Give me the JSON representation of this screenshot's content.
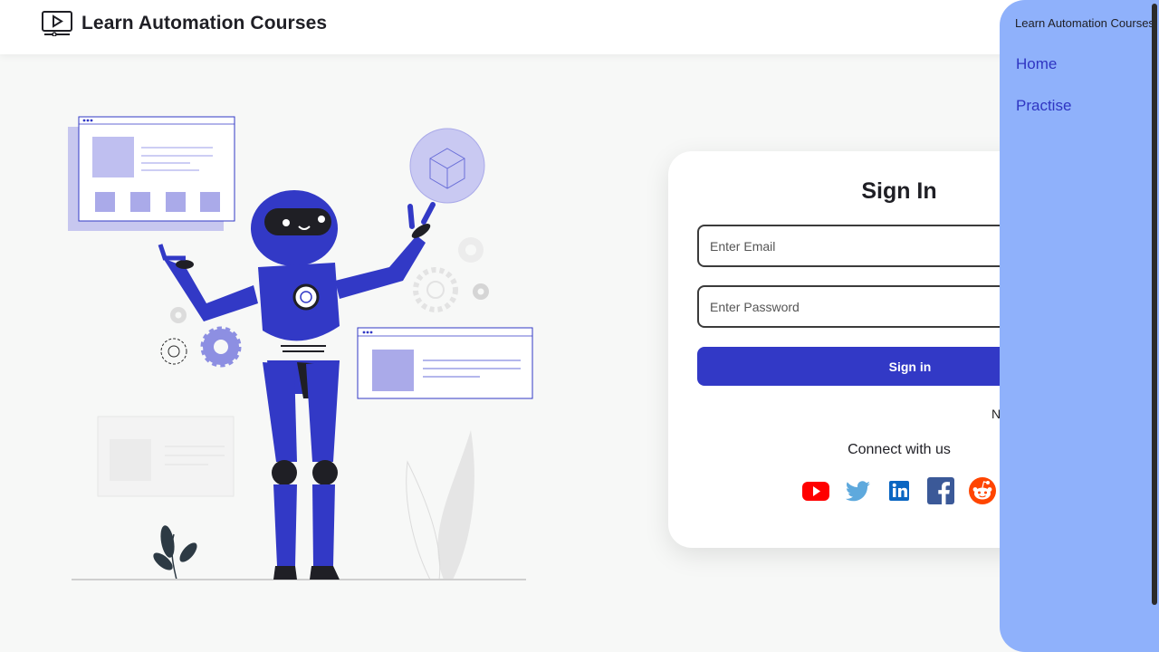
{
  "header": {
    "brand_icon": "video-player-icon",
    "brand_title": "Learn Automation Courses"
  },
  "illustration": {
    "subject": "robot-illustration"
  },
  "signin": {
    "title": "Sign In",
    "email_placeholder": "Enter Email",
    "password_placeholder": "Enter Password",
    "button_label": "Sign in",
    "partial_text": "N",
    "connect_label": "Connect with us",
    "socials": [
      {
        "icon": "youtube-icon",
        "color": "#ff0000"
      },
      {
        "icon": "twitter-icon",
        "color": "#5ea9dd"
      },
      {
        "icon": "linkedin-icon",
        "color": "#0a66c2"
      },
      {
        "icon": "facebook-icon",
        "color": "#3b5998"
      },
      {
        "icon": "reddit-icon",
        "color": "#ff4500"
      }
    ]
  },
  "sidebar": {
    "title": "Learn Automation Courses",
    "items": [
      {
        "label": "Home"
      },
      {
        "label": "Practise"
      }
    ]
  },
  "colors": {
    "accent": "#3239c6",
    "sidebar_bg": "#8fb1fb",
    "page_bg": "#f7f8f7"
  }
}
